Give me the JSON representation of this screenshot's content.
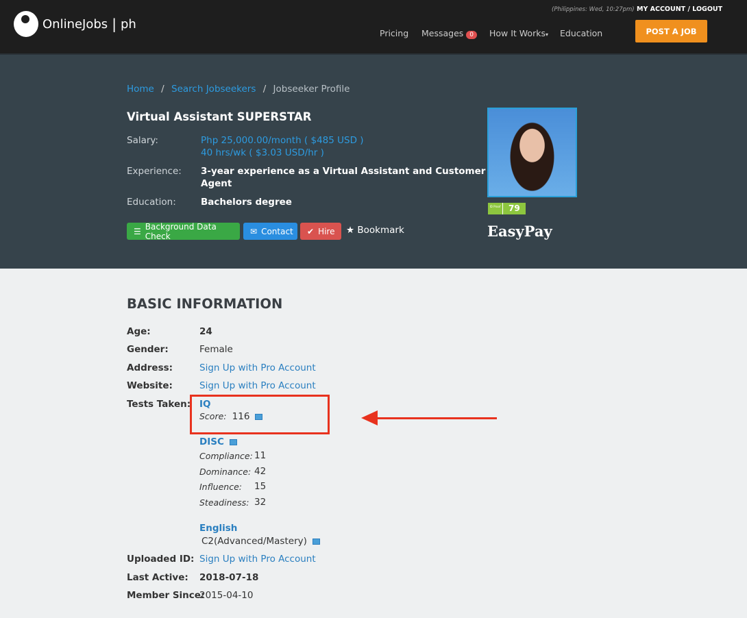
{
  "header": {
    "logo_text": "OnlineJobs",
    "logo_suffix": "ph",
    "timestamp": "(Philippines: Wed, 10:27pm)",
    "account": "MY ACCOUNT / LOGOUT",
    "nav": [
      {
        "label": "Pricing"
      },
      {
        "label": "Messages",
        "badge": "0"
      },
      {
        "label": "How It Works"
      },
      {
        "label": "Education"
      }
    ],
    "post_job": "POST A JOB",
    "accent": "#f0901e"
  },
  "breadcrumb": {
    "home": "Home",
    "search": "Search Jobseekers",
    "current": "Jobseeker Profile"
  },
  "profile": {
    "title": "Virtual Assistant SUPERSTAR",
    "salary_label": "Salary:",
    "salary_1": "Php 25,000.00/month ( $485 USD )",
    "salary_2": "40 hrs/wk ( $3.03 USD/hr )",
    "experience_label": "Experience:",
    "experience_1": "3-year experience as a Virtual Assistant and Customer Service",
    "experience_2": "Agent",
    "education_label": "Education:",
    "education": "Bachelors degree",
    "buttons": {
      "bg_check": "Background Data Check",
      "contact": "Contact",
      "hire": "Hire",
      "bookmark": "Bookmark"
    },
    "id_proof_label": "ID Proof",
    "id_proof_score": "79",
    "easypay": "EasyPay"
  },
  "basic": {
    "heading": "BASIC INFORMATION",
    "age_label": "Age:",
    "age": "24",
    "gender_label": "Gender:",
    "gender": "Female",
    "address_label": "Address:",
    "address": "Sign Up with Pro Account",
    "website_label": "Website:",
    "website": "Sign Up with Pro Account",
    "tests_label": "Tests Taken:",
    "iq": {
      "name": "IQ",
      "score_label": "Score:",
      "score": "116"
    },
    "disc": {
      "name": "DISC",
      "compliance_label": "Compliance:",
      "compliance": "11",
      "dominance_label": "Dominance:",
      "dominance": "42",
      "influence_label": "Influence:",
      "influence": "15",
      "steadiness_label": "Steadiness:",
      "steadiness": "32"
    },
    "english": {
      "name": "English",
      "level": "C2(Advanced/Mastery)"
    },
    "uploaded_label": "Uploaded ID:",
    "uploaded": "Sign Up with Pro Account",
    "last_active_label": "Last Active:",
    "last_active": "2018-07-18",
    "member_label": "Member Since:",
    "member": "2015-04-10"
  }
}
